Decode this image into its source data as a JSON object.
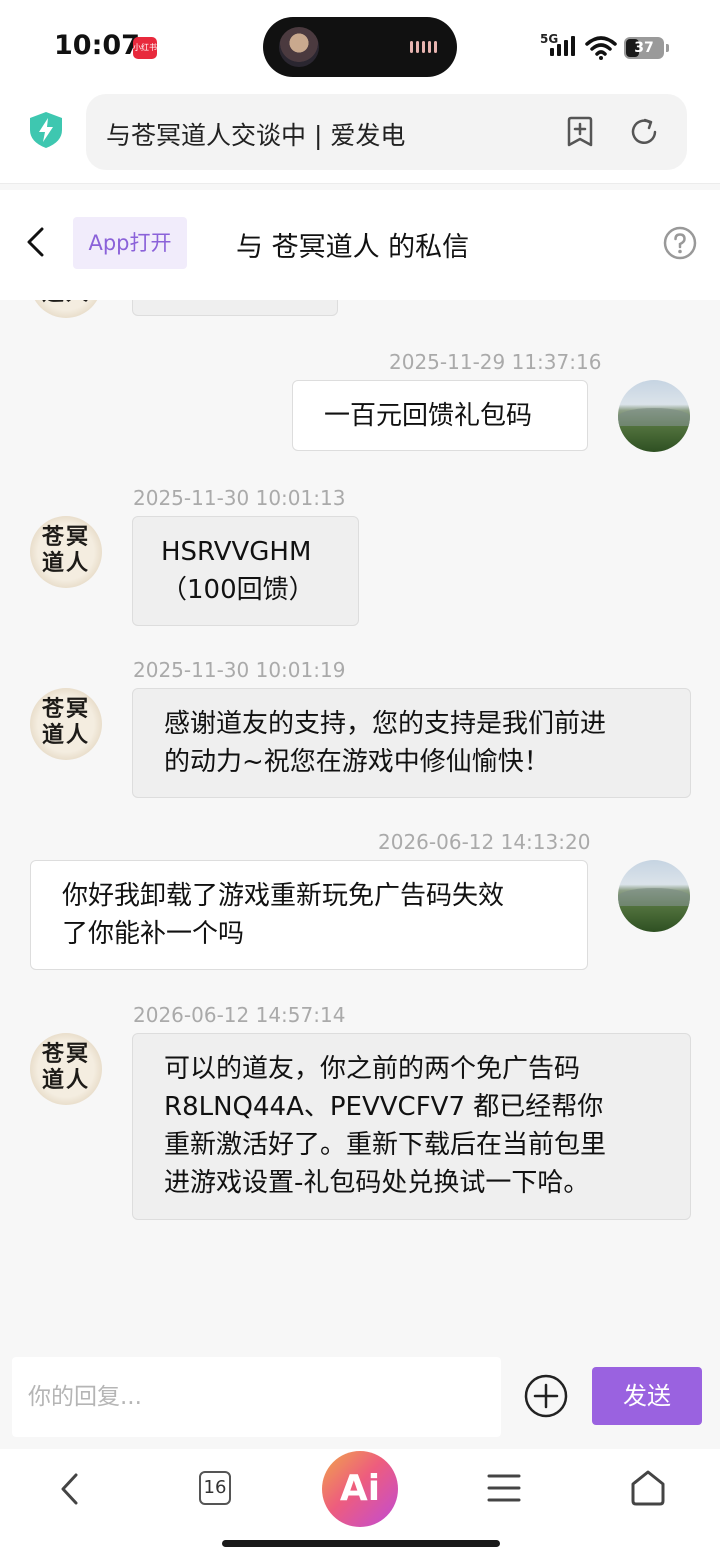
{
  "status_bar": {
    "time": "10:07",
    "app_badge": "小红书",
    "network": "5G",
    "battery": "37",
    "battery_level_percent": 37
  },
  "browser": {
    "url_title": "与苍冥道人交谈中 | 爱发电"
  },
  "chat_header": {
    "open_app_label": "App打开",
    "title": "与 苍冥道人 的私信"
  },
  "contact_avatar_text": [
    "苍冥",
    "道人"
  ],
  "messages": [
    {
      "side": "out",
      "time": "2025-11-29 11:37:16",
      "lines": [
        "一百元回馈礼包码"
      ]
    },
    {
      "side": "in",
      "time": "2025-11-30 10:01:13",
      "lines": [
        "HSRVVGHM",
        "（100回馈）"
      ]
    },
    {
      "side": "in",
      "time": "2025-11-30 10:01:19",
      "lines": [
        "感谢道友的支持，您的支持是我们前进",
        "的动力~祝您在游戏中修仙愉快！"
      ]
    },
    {
      "side": "out",
      "time": "2026-06-12 14:13:20",
      "lines": [
        "你好我卸载了游戏重新玩免广告码失效",
        "了你能补一个吗"
      ]
    },
    {
      "side": "in",
      "time": "2026-06-12 14:57:14",
      "lines": [
        "可以的道友，你之前的两个免广告码",
        "R8LNQ44A、PEVVCFV7 都已经帮你",
        "重新激活好了。重新下载后在当前包里",
        "进游戏设置-礼包码处兑换试一下哈。"
      ]
    }
  ],
  "input": {
    "placeholder": "你的回复...",
    "value": "",
    "send_label": "发送"
  },
  "bottom_nav": {
    "tab_count": "16",
    "ai_label": "Ai"
  },
  "colors": {
    "accent": "#9a62e0",
    "open_app_text": "#8b62d9",
    "shield": "#3ec7b0"
  }
}
